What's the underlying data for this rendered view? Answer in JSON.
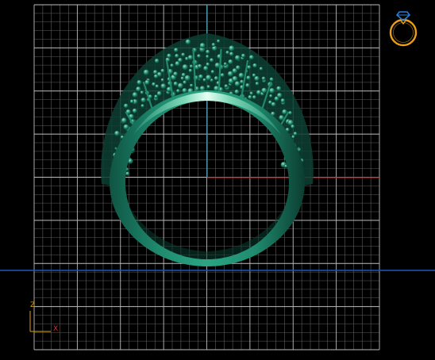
{
  "viewport": {
    "view": "front",
    "grid": true
  },
  "colors": {
    "background": "#000000",
    "grid_major": "#bcbcbc",
    "grid_minor": "#5e5e5e",
    "axis_vertical": "#1a8fa8",
    "axis_horizontal": "#9b1c1c",
    "ground_line": "#1f55c4",
    "ring_metal": "#1f8a6e",
    "ring_highlight": "#bff0dc",
    "ring_shadow": "#0b3d30",
    "triad_axis": "#b8860b",
    "triad_x_label": "#e03030",
    "triad_z_label": "#d4a017",
    "view_icon": "#e8a012",
    "view_icon_gem": "#2a7bd4"
  },
  "axis_triad": {
    "z_label": "Z",
    "x_label": "X"
  },
  "view_icon": {
    "name": "ring-view-icon"
  }
}
